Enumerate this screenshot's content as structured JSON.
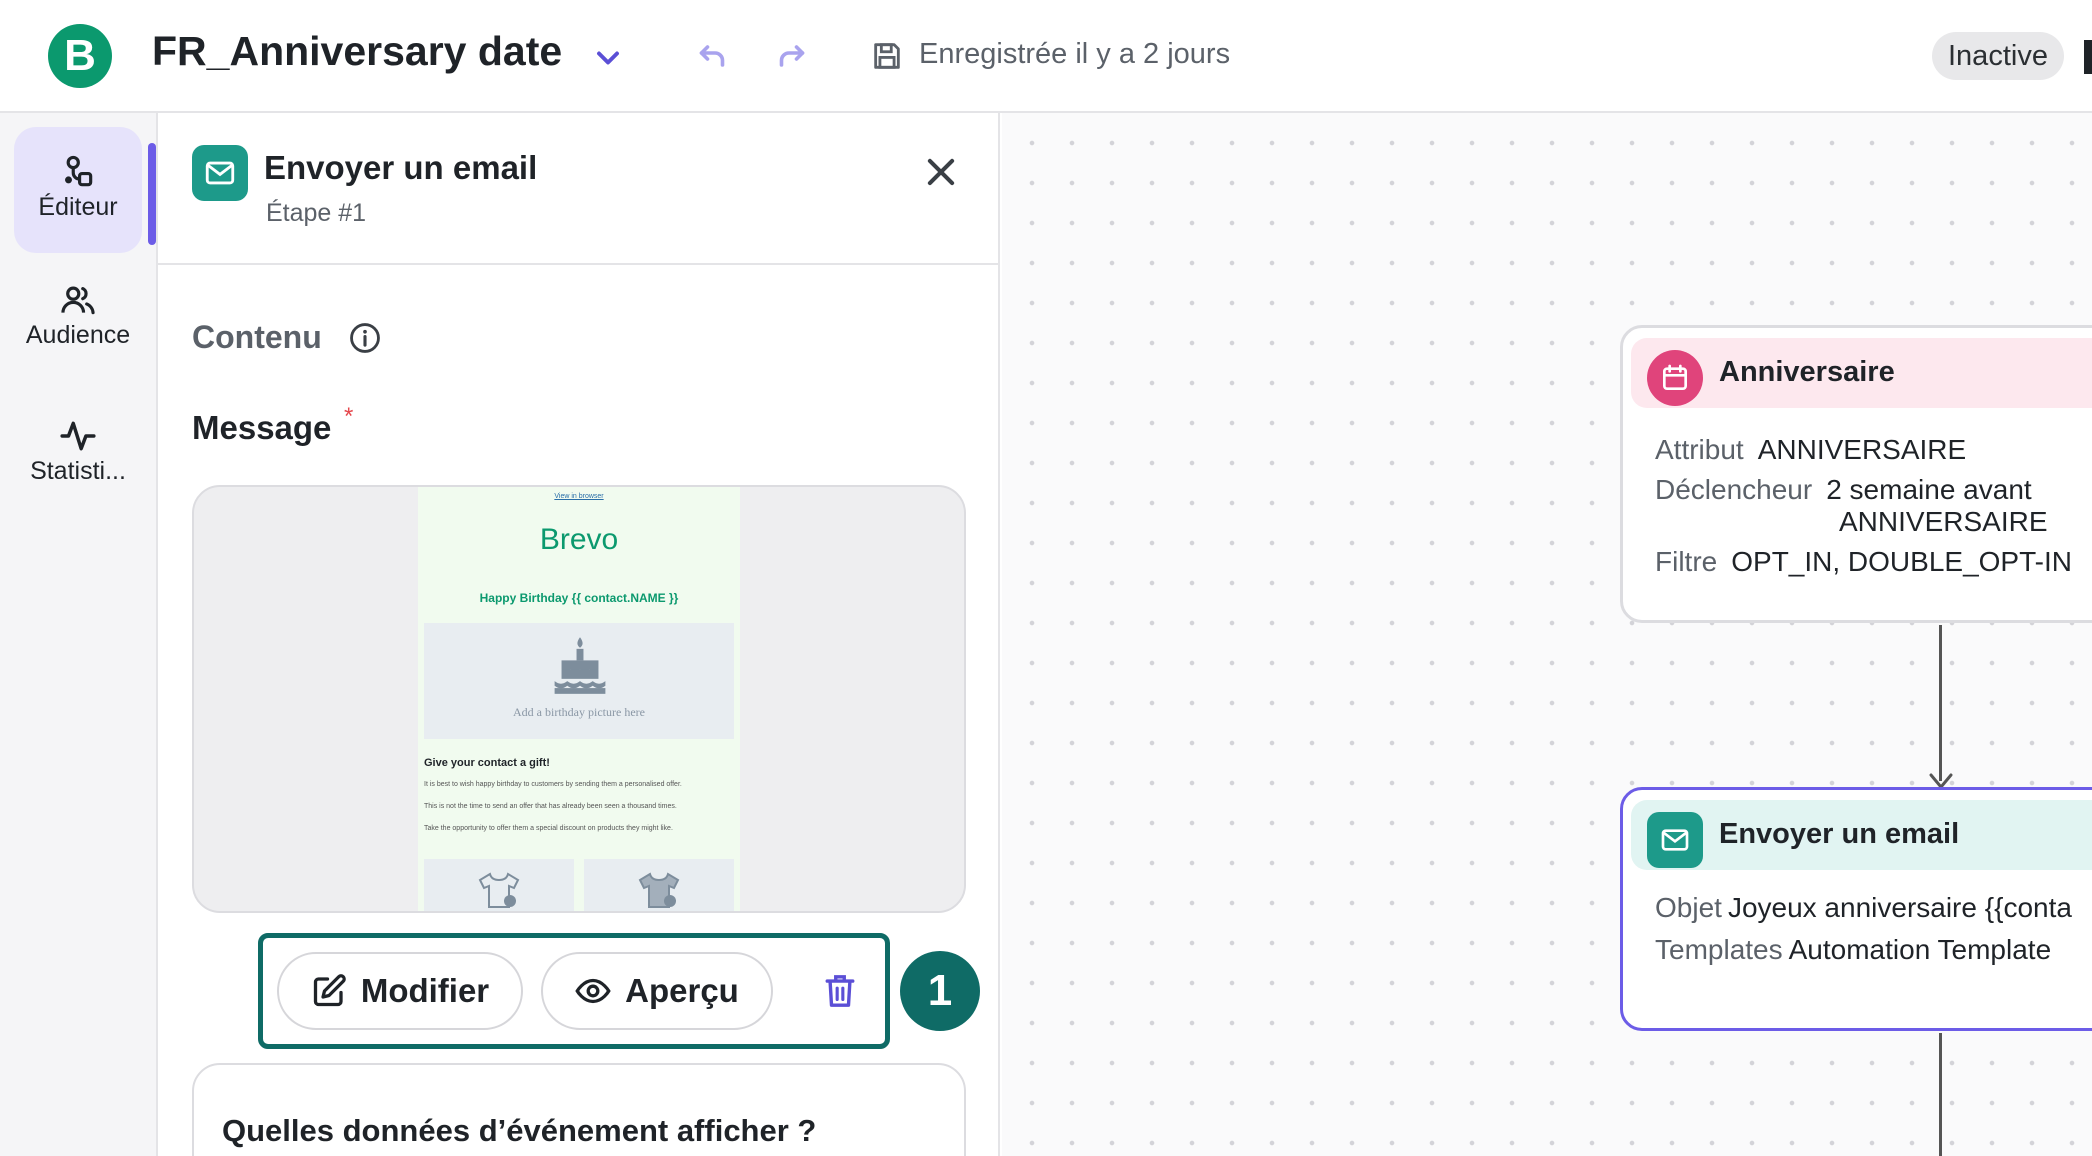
{
  "header": {
    "logo_letter": "B",
    "title": "FR_Anniversary date",
    "saved_status": "Enregistrée il y a 2 jours",
    "workflow_status": "Inactive"
  },
  "rail": {
    "items": [
      {
        "label": "Éditeur",
        "active": true
      },
      {
        "label": "Audience",
        "active": false
      },
      {
        "label": "Statisti...",
        "active": false
      }
    ]
  },
  "panel": {
    "title": "Envoyer un email",
    "step": "Étape #1",
    "content_label": "Contenu",
    "message_label": "Message",
    "required_mark": "*",
    "email_preview": {
      "view_link": "View in browser",
      "brand": "Brevo",
      "greeting": "Happy Birthday {{ contact.NAME }}",
      "image_placeholder": "Add a birthday picture here",
      "gift_title": "Give your contact a gift!",
      "paragraphs": [
        "It is best to wish happy birthday to customers by sending them a personalised offer.",
        "This is not the time to send an offer that has already been seen a thousand times.",
        "Take the opportunity to offer them a special discount on products they might like."
      ]
    },
    "buttons": {
      "modify": "Modifier",
      "preview": "Aperçu"
    },
    "step_badge": "1",
    "event_question": "Quelles données d’événement afficher ?"
  },
  "canvas": {
    "trigger_node": {
      "title": "Anniversaire",
      "rows": [
        {
          "key": "Attribut",
          "value": "ANNIVERSAIRE"
        },
        {
          "key": "Déclencheur",
          "value": "2 semaine avant",
          "value2": "ANNIVERSAIRE"
        },
        {
          "key": "Filtre",
          "value": "OPT_IN, DOUBLE_OPT-IN"
        }
      ]
    },
    "email_node": {
      "title": "Envoyer un email",
      "rows": [
        {
          "key": "Objet",
          "value": "Joyeux anniversaire {{conta"
        },
        {
          "key": "Templates",
          "value": "Automation Template"
        }
      ]
    }
  },
  "colors": {
    "brand_green": "#0b996e",
    "accent_purple": "#6c5ce7",
    "teal": "#1d9a8a",
    "highlight": "#0f6b66",
    "pink": "#e0447b"
  }
}
